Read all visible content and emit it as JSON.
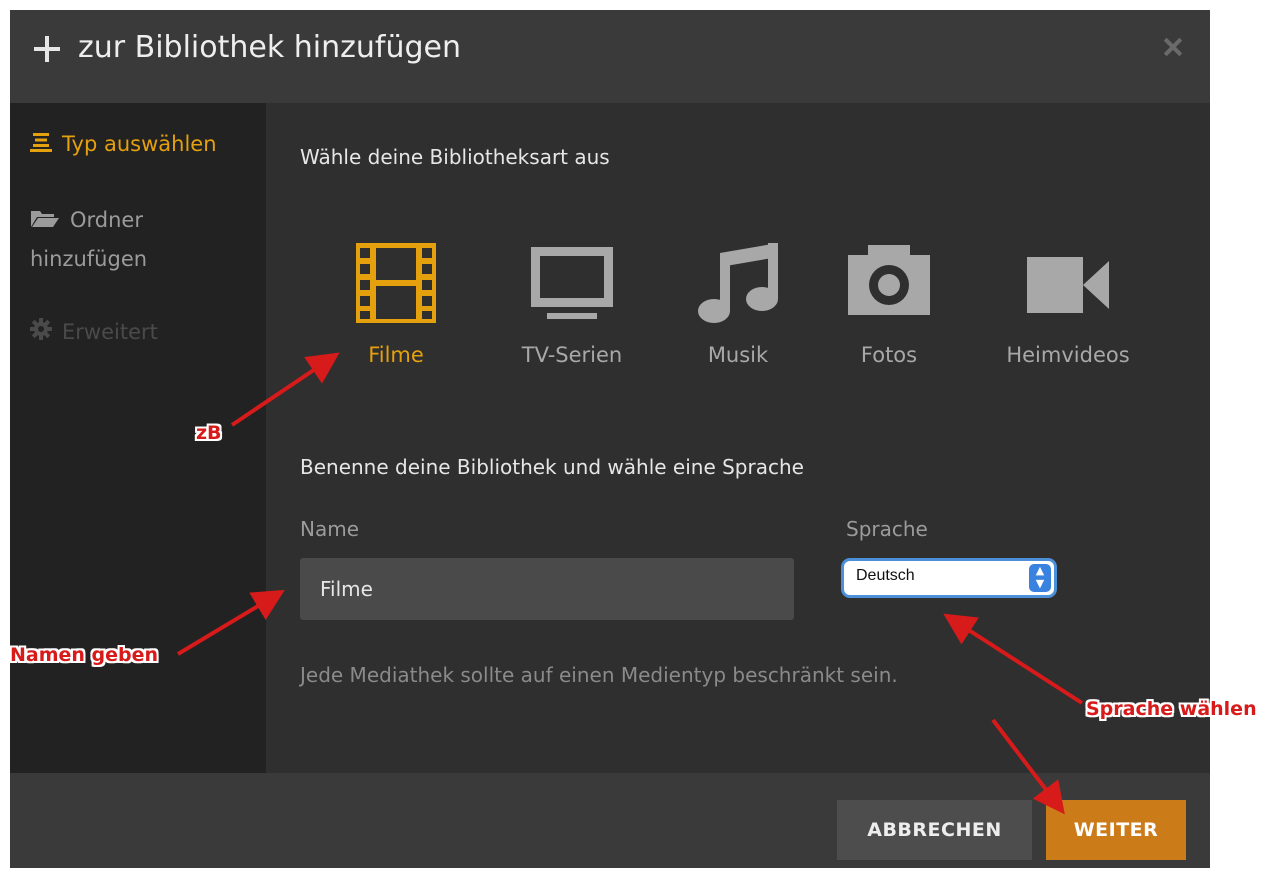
{
  "dialog": {
    "title": "zur Bibliothek hinzufügen",
    "close_icon": "close-icon",
    "add_icon": "plus-icon"
  },
  "sidebar": {
    "items": [
      {
        "label": "Typ auswählen",
        "icon": "list-icon",
        "state": "active"
      },
      {
        "label": "Ordner hinzufügen",
        "icon": "folder-icon",
        "state": "normal"
      },
      {
        "label": "Erweitert",
        "icon": "gear-icon",
        "state": "disabled"
      }
    ]
  },
  "main": {
    "heading": "Wähle deine Bibliotheksart aus",
    "library_types": [
      {
        "label": "Filme",
        "icon": "film-icon",
        "selected": true
      },
      {
        "label": "TV-Serien",
        "icon": "tv-icon",
        "selected": false
      },
      {
        "label": "Musik",
        "icon": "music-icon",
        "selected": false
      },
      {
        "label": "Fotos",
        "icon": "camera-icon",
        "selected": false
      },
      {
        "label": "Heimvideos",
        "icon": "video-camera-icon",
        "selected": false
      }
    ],
    "name_section_heading": "Benenne deine Bibliothek und wähle eine Sprache",
    "name_label": "Name",
    "name_value": "Filme",
    "language_label": "Sprache",
    "language_value": "Deutsch",
    "hint": "Jede Mediathek sollte auf einen Medientyp beschränkt sein."
  },
  "footer": {
    "cancel_label": "ABBRECHEN",
    "next_label": "WEITER"
  },
  "annotations": {
    "example": "zB",
    "name": "Namen geben",
    "language": "Sprache wählen"
  },
  "colors": {
    "accent": "#e5a00d",
    "primary_button": "#cc7b19",
    "annotation": "#d71a1a"
  }
}
